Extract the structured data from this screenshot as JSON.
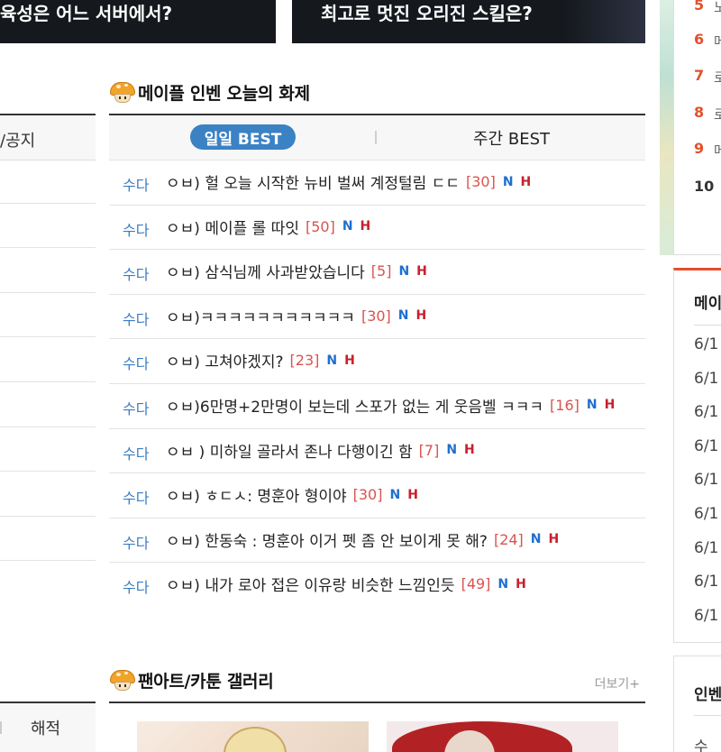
{
  "banners": {
    "left_text": "육성은 어느 서버에서?",
    "right_text": "최고로 멋진 오리진 스킬은?"
  },
  "left_column": {
    "header": "/공지",
    "bottom_tab": "해적"
  },
  "topics": {
    "title": "메이플 인벤 오늘의 화제",
    "tab_daily": "일일 BEST",
    "tab_weekly": "주간 BEST",
    "rows": [
      {
        "category": "수다",
        "title": "ㅇㅂ) 헐 오늘 시작한 뉴비 벌써 계정털림 ㄷㄷ",
        "count": "[30]",
        "new": "N",
        "hot": "H"
      },
      {
        "category": "수다",
        "title": "ㅇㅂ) 메이플 롤 따잇",
        "count": "[50]",
        "new": "N",
        "hot": "H"
      },
      {
        "category": "수다",
        "title": "ㅇㅂ) 삼식님께 사과받았습니다",
        "count": "[5]",
        "new": "N",
        "hot": "H"
      },
      {
        "category": "수다",
        "title": "ㅇㅂ)ㅋㅋㅋㅋㅋㅋㅋㅋㅋㅋㅋ",
        "count": "[30]",
        "new": "N",
        "hot": "H"
      },
      {
        "category": "수다",
        "title": "ㅇㅂ) 고쳐야겠지?",
        "count": "[23]",
        "new": "N",
        "hot": "H"
      },
      {
        "category": "수다",
        "title": "ㅇㅂ)6만명+2만명이 보는데 스포가 없는 게 웃음벨 ㅋㅋㅋ",
        "count": "[16]",
        "new": "N",
        "hot": "H"
      },
      {
        "category": "수다",
        "title": "ㅇㅂ ) 미하일 골라서 존나 다행이긴 함",
        "count": "[7]",
        "new": "N",
        "hot": "H"
      },
      {
        "category": "수다",
        "title": "ㅇㅂ) ㅎㄷㅅ: 명훈아 형이야",
        "count": "[30]",
        "new": "N",
        "hot": "H"
      },
      {
        "category": "수다",
        "title": "ㅇㅂ) 한동숙 : 명훈아 이거 펫 좀 안 보이게 못 해?",
        "count": "[24]",
        "new": "N",
        "hot": "H"
      },
      {
        "category": "수다",
        "title": "ㅇㅂ) 내가 로아 접은 이유랑 비슷한 느낌인듯",
        "count": "[49]",
        "new": "N",
        "hot": "H"
      }
    ]
  },
  "gallery": {
    "title": "팬아트/카툰 갤러리",
    "more": "더보기+"
  },
  "right_column": {
    "ranks": [
      {
        "num": "5",
        "tail": "노"
      },
      {
        "num": "6",
        "tail": "메"
      },
      {
        "num": "7",
        "tail": "로"
      },
      {
        "num": "8",
        "tail": "로"
      },
      {
        "num": "9",
        "tail": "메"
      },
      {
        "num": "10",
        "tail": ""
      }
    ],
    "box2_title": "메이",
    "dates": [
      "6/1",
      "6/1",
      "6/1",
      "6/1",
      "6/1",
      "6/1",
      "6/1",
      "6/1",
      "6/1"
    ],
    "box3_title": "인벤",
    "box3_text": "수"
  },
  "colors": {
    "accent_blue": "#3b82c4",
    "category_blue": "#3b7cc0",
    "count_red": "#d9534f",
    "new_blue": "#1f6fcf",
    "hot_red": "#c8202c",
    "rank_orange": "#e4502c"
  }
}
